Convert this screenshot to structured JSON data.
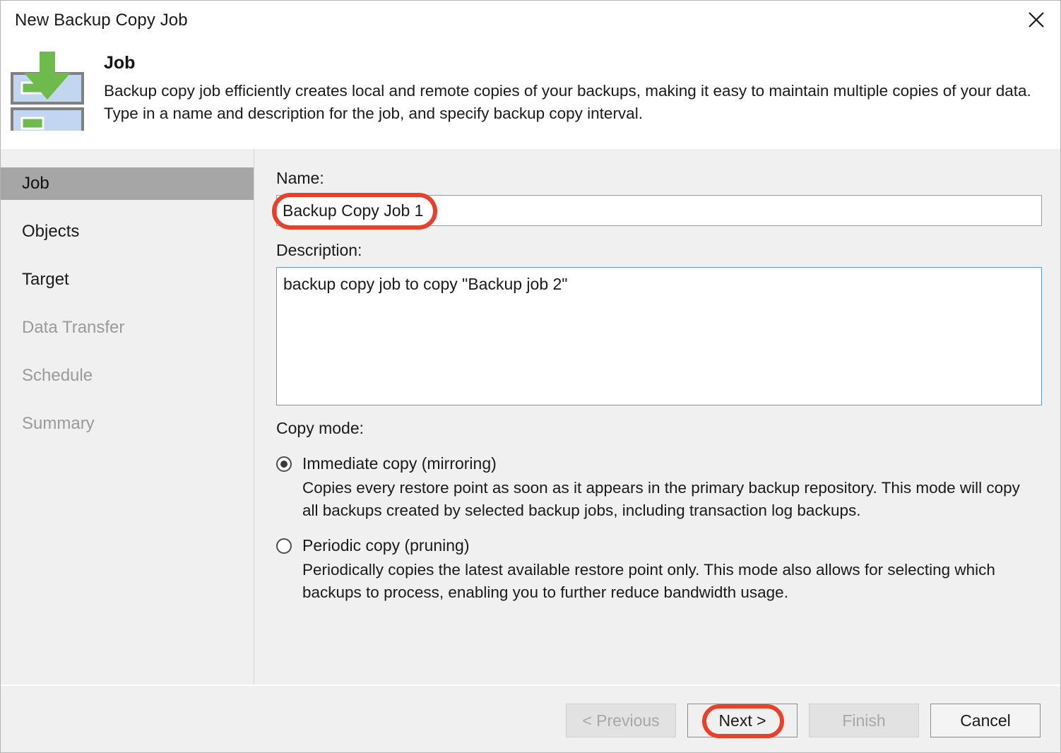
{
  "window": {
    "title": "New Backup Copy Job",
    "close_icon": "close-icon"
  },
  "header": {
    "icon": "backup-copy-job-icon",
    "title": "Job",
    "description": "Backup copy job efficiently creates local and remote copies of your backups, making it easy to maintain multiple copies of your data. Type in a name and description for the job, and specify backup copy interval."
  },
  "sidebar": {
    "items": [
      {
        "label": "Job",
        "state": "selected"
      },
      {
        "label": "Objects",
        "state": "enabled"
      },
      {
        "label": "Target",
        "state": "enabled"
      },
      {
        "label": "Data Transfer",
        "state": "disabled"
      },
      {
        "label": "Schedule",
        "state": "disabled"
      },
      {
        "label": "Summary",
        "state": "disabled"
      }
    ]
  },
  "form": {
    "name_label": "Name:",
    "name_value": "Backup Copy Job 1",
    "name_placeholder": "",
    "description_label": "Description:",
    "description_value": "backup copy job to copy \"Backup job 2\"",
    "description_placeholder": "",
    "copy_mode_label": "Copy mode:",
    "copy_mode_options": [
      {
        "label": "Immediate copy (mirroring)",
        "selected": true,
        "description": "Copies every restore point as soon as it appears in the primary backup repository. This mode will copy all backups created by selected backup jobs, including transaction log backups."
      },
      {
        "label": "Periodic copy (pruning)",
        "selected": false,
        "description": "Periodically copies the latest available restore point only. This mode also allows for selecting which backups to process, enabling you to further reduce bandwidth usage."
      }
    ]
  },
  "footer": {
    "previous_label": "< Previous",
    "next_label": "Next >",
    "finish_label": "Finish",
    "cancel_label": "Cancel"
  },
  "annotations": {
    "accent_color": "#e8402a",
    "highlighted": [
      "name-input",
      "next-button"
    ]
  }
}
